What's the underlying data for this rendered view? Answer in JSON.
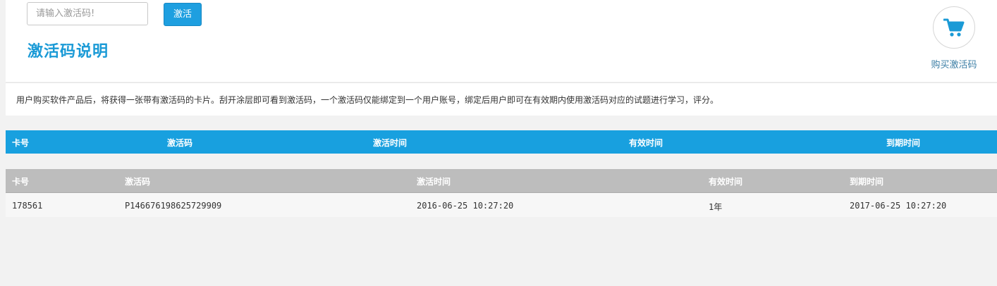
{
  "activation": {
    "input_placeholder": "请输入激活码!",
    "input_value": "",
    "activate_label": "激活",
    "section_title": "激活码说明"
  },
  "buy": {
    "label": "购买激活码",
    "icon": "shopping-cart-icon",
    "icon_color": "#1a9ad6"
  },
  "description": "用户购买软件产品后，将获得一张带有激活码的卡片。刮开涂层即可看到激活码，一个激活码仅能绑定到一个用户账号，绑定后用户即可在有效期内使用激活码对应的试题进行学习，评分。",
  "header_table": {
    "columns": [
      "卡号",
      "激活码",
      "激活时间",
      "有效时间",
      "到期时间"
    ],
    "color": "#18a0df"
  },
  "records_table": {
    "columns": [
      "卡号",
      "激活码",
      "激活时间",
      "有效时间",
      "到期时间"
    ],
    "rows": [
      [
        "178561",
        "P146676198625729909",
        "2016-06-25 10:27:20",
        "1年",
        "2017-06-25 10:27:20"
      ]
    ]
  }
}
